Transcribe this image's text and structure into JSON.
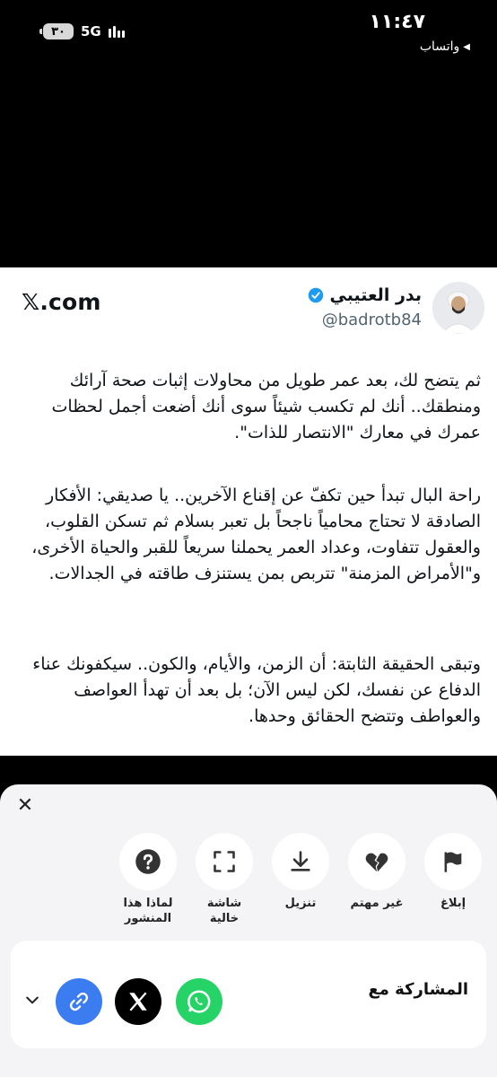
{
  "status_bar": {
    "time": "١١:٤٧",
    "back_app": "واتساب",
    "battery": "٣٠",
    "network": "5G"
  },
  "tweet": {
    "author_name": "بدر العتيبي",
    "handle": "@badrotb84",
    "site": "𝕏.com",
    "paragraphs": [
      "ثم يتضح لك، بعد عمر طويل من محاولات إثبات صحة آرائك ومنطقك.. أنك لم تكسب شيئاً سوى أنك أضعت أجمل لحظات عمرك في معارك \"الانتصار للذات\".",
      "راحة البال تبدأ حين تكفّ عن إقناع الآخرين.. يا صديقي: الأفكار الصادقة لا تحتاج محامياً ناجحاً بل تعبر بسلام ثم تسكن القلوب، والعقول تتفاوت، وعداد العمر يحملنا سريعاً للقبر والحياة الأخرى، و\"الأمراض المزمنة\" تتربص بمن يستنزف طاقته في الجدالات.",
      "وتبقى الحقيقة الثابتة: أن الزمن، والأيام، والكون.. سيكفونك عناء الدفاع عن نفسك، لكن ليس الآن؛ بل بعد أن تهدأ العواصف والعواطف وتتضح الحقائق وحدها."
    ]
  },
  "sheet": {
    "actions": [
      {
        "label": "إبلاغ",
        "icon": "flag-icon"
      },
      {
        "label": "غير مهتم",
        "icon": "broken-heart-icon"
      },
      {
        "label": "تنزيل",
        "icon": "download-icon"
      },
      {
        "label": "شاشة خالية",
        "icon": "fullscreen-icon"
      },
      {
        "label": "لماذا هذا المنشور",
        "icon": "question-icon"
      }
    ],
    "share_label": "المشاركة مع",
    "share_targets": [
      "whatsapp-icon",
      "x-icon",
      "link-icon"
    ]
  },
  "colors": {
    "whatsapp": "#25d366",
    "link": "#3b7cf0",
    "x": "#000000",
    "verified": "#1d9bf0"
  }
}
